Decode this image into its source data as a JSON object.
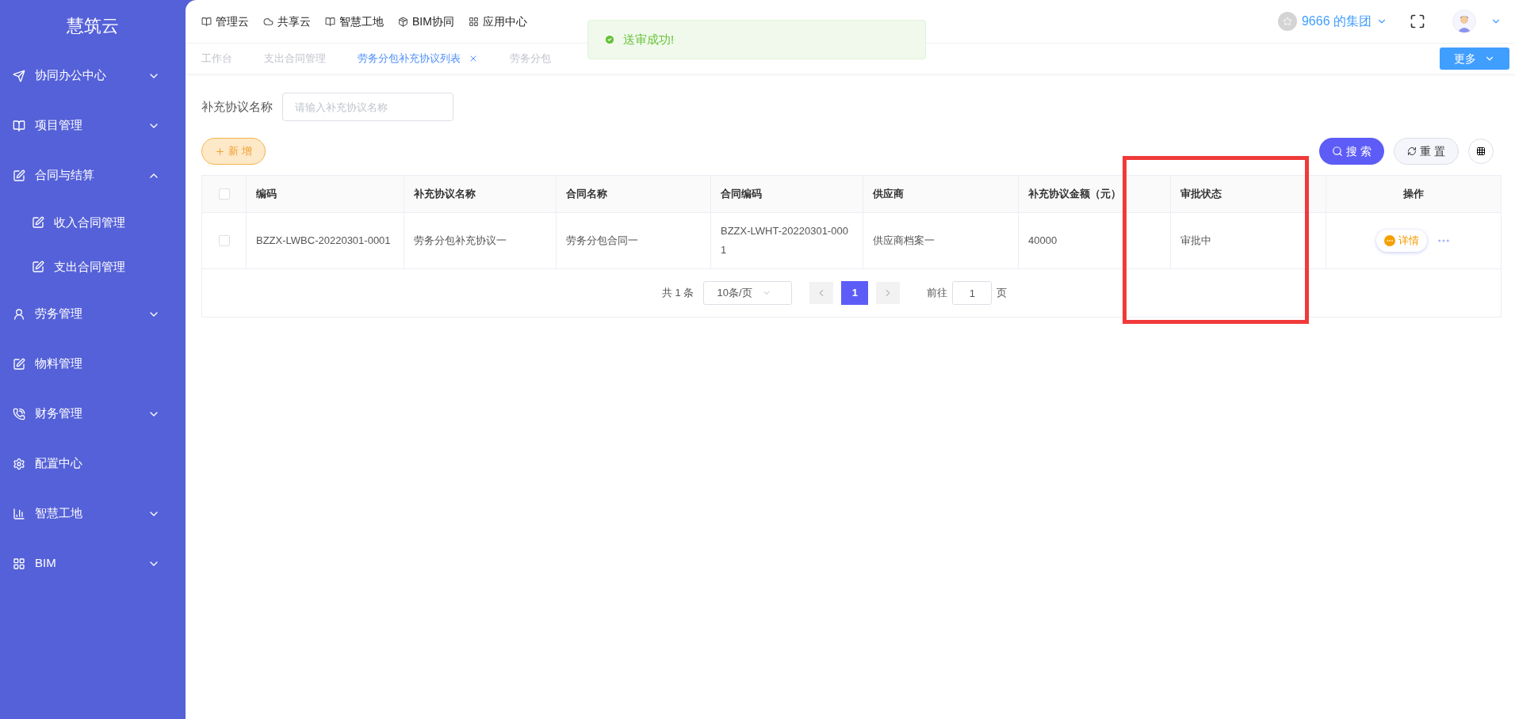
{
  "sidebar": {
    "title": "慧筑云",
    "items": [
      {
        "kind": "group",
        "label": "协同办公中心",
        "expanded": false
      },
      {
        "kind": "group",
        "label": "项目管理",
        "expanded": false
      },
      {
        "kind": "group",
        "label": "合同与结算",
        "expanded": true,
        "children": [
          {
            "label": "收入合同管理"
          },
          {
            "label": "支出合同管理"
          }
        ]
      },
      {
        "kind": "group",
        "label": "劳务管理",
        "expanded": false
      },
      {
        "kind": "link",
        "label": "物料管理"
      },
      {
        "kind": "group",
        "label": "财务管理",
        "expanded": false
      },
      {
        "kind": "link",
        "label": "配置中心"
      },
      {
        "kind": "group",
        "label": "智慧工地",
        "expanded": false
      },
      {
        "kind": "group",
        "label": "BIM",
        "expanded": false
      }
    ]
  },
  "top_nav": [
    {
      "label": "管理云"
    },
    {
      "label": "共享云"
    },
    {
      "label": "智慧工地"
    },
    {
      "label": "BIM协同"
    },
    {
      "label": "应用中心"
    }
  ],
  "org": {
    "label": "9666 的集团"
  },
  "tabs": [
    {
      "label": "工作台",
      "selected": false
    },
    {
      "label": "支出合同管理",
      "selected": false
    },
    {
      "label": "劳务分包补充协议列表",
      "selected": true
    },
    {
      "label": "劳务分包",
      "selected": false
    }
  ],
  "more_button": "更多",
  "toast": {
    "message": "送审成功!"
  },
  "filter": {
    "label": "补充协议名称",
    "placeholder": "请输入补充协议名称"
  },
  "add_button": "新 增",
  "search_button": "搜 索",
  "reset_button": "重 置",
  "table": {
    "select_all_checked": false,
    "columns": [
      "编码",
      "补充协议名称",
      "合同名称",
      "合同编码",
      "供应商",
      "补充协议金额（元）",
      "审批状态",
      "操作"
    ],
    "rows": [
      {
        "checked": false,
        "cells": [
          "BZZX-LWBC-20220301-0001",
          "劳务分包补充协议一",
          "劳务分包合同一",
          "BZZX-LWHT-20220301-0001",
          "供应商档案一",
          "40000",
          "审批中"
        ],
        "action": "详情"
      }
    ]
  },
  "pagination": {
    "total": "共 1 条",
    "page_size": "10条/页",
    "pages": [
      {
        "label": "1",
        "selected": true
      }
    ],
    "goto_label": "前往",
    "goto_value": "1",
    "goto_suffix": "页"
  }
}
